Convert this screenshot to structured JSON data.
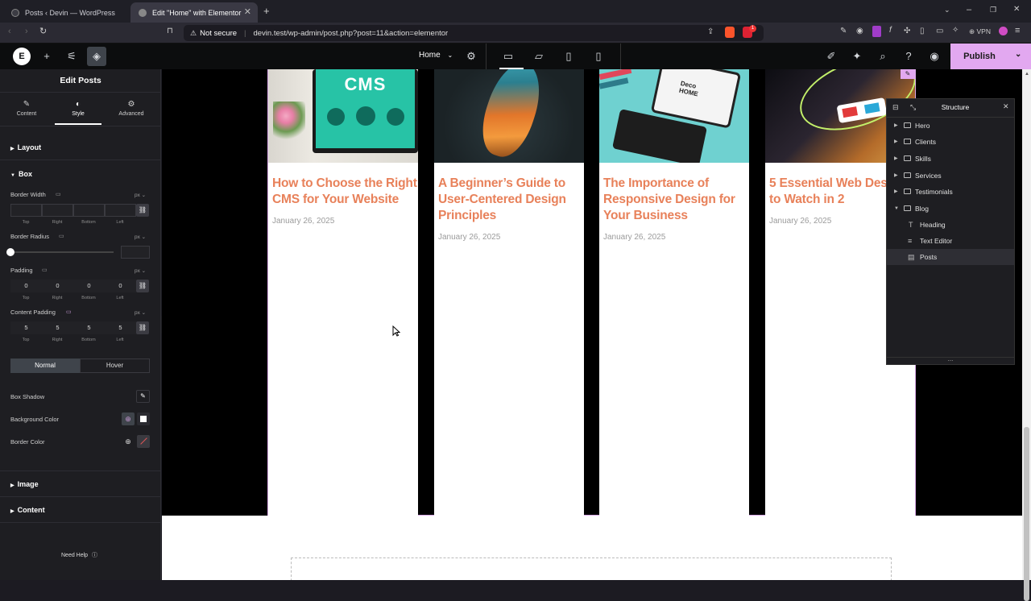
{
  "browser": {
    "tabs": [
      {
        "title": "Posts ‹ Devin — WordPress"
      },
      {
        "title": "Edit \"Home\" with Elementor",
        "active": true
      }
    ],
    "security": "Not secure",
    "url": "devin.test/wp-admin/post.php?post=11&action=elementor",
    "vpn_label": "VPN",
    "shield_badge": "1"
  },
  "topbar": {
    "page_selector": "Home",
    "publish_label": "Publish"
  },
  "panel": {
    "title": "Edit Posts",
    "tabs": [
      "Content",
      "Style",
      "Advanced"
    ],
    "active_tab": "Style",
    "sections": {
      "layout": "Layout",
      "box": "Box",
      "image": "Image",
      "content": "Content"
    },
    "border_width": {
      "label": "Border Width",
      "unit": "px",
      "values": [
        "",
        "",
        "",
        ""
      ]
    },
    "border_radius": {
      "label": "Border Radius",
      "unit": "px",
      "value": ""
    },
    "padding": {
      "label": "Padding",
      "unit": "px",
      "values": [
        "0",
        "0",
        "0",
        "0"
      ]
    },
    "content_padding": {
      "label": "Content Padding",
      "unit": "px",
      "values": [
        "5",
        "5",
        "5",
        "5"
      ]
    },
    "sides": [
      "Top",
      "Right",
      "Bottom",
      "Left"
    ],
    "state_tabs": [
      "Normal",
      "Hover"
    ],
    "box_shadow": "Box Shadow",
    "background_color": "Background Color",
    "border_color": "Border Color",
    "need_help": "Need Help"
  },
  "posts": [
    {
      "title": "How to Choose the Right CMS for Your Website",
      "date": "January 26, 2025",
      "image_text": "CMS"
    },
    {
      "title": "A Beginner’s Guide to User-Centered Design Principles",
      "date": "January 26, 2025"
    },
    {
      "title": "The Importance of Responsive Design for Your Business",
      "date": "January 26, 2025"
    },
    {
      "title": "5 Essential Web Design Trends to Watch in 2",
      "date": "January 26, 2025"
    }
  ],
  "structure": {
    "title": "Structure",
    "items": [
      {
        "label": "Hero"
      },
      {
        "label": "Clients"
      },
      {
        "label": "Skills"
      },
      {
        "label": "Services"
      },
      {
        "label": "Testimonials"
      },
      {
        "label": "Blog"
      },
      {
        "label": "Heading"
      },
      {
        "label": "Text Editor"
      },
      {
        "label": "Posts"
      }
    ],
    "more": "..."
  },
  "colors": {
    "accent": "#e2a8f0",
    "post_title": "#e8815a"
  }
}
